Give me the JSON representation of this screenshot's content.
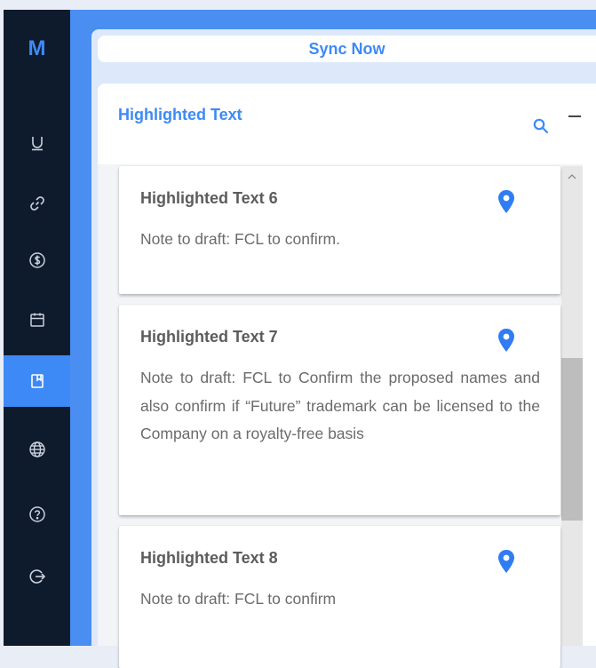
{
  "sidebar": {
    "logo": "M",
    "items": [
      {
        "icon": "underline-icon"
      },
      {
        "icon": "link-icon"
      },
      {
        "icon": "dollar-icon"
      },
      {
        "icon": "calendar-icon"
      },
      {
        "icon": "bookmark-icon",
        "active": true
      },
      {
        "icon": "globe-icon"
      },
      {
        "icon": "help-icon"
      },
      {
        "icon": "logout-icon"
      }
    ]
  },
  "toolbar": {
    "sync_label": "Sync Now"
  },
  "section": {
    "title": "Highlighted Text"
  },
  "colors": {
    "accent": "#3d8af7",
    "sidebar_bg": "#0e1b2c",
    "pin": "#2f7cf3"
  },
  "cards": [
    {
      "title": "Highlighted Text 6",
      "text": "Note to draft: FCL to confirm."
    },
    {
      "title": "Highlighted Text 7",
      "text": "Note to draft: FCL to Confirm the proposed names and also confirm if “Future” trademark can be licensed to the Company on a royalty-free basis"
    },
    {
      "title": "Highlighted Text 8",
      "text": "Note to draft: FCL to confirm"
    }
  ]
}
